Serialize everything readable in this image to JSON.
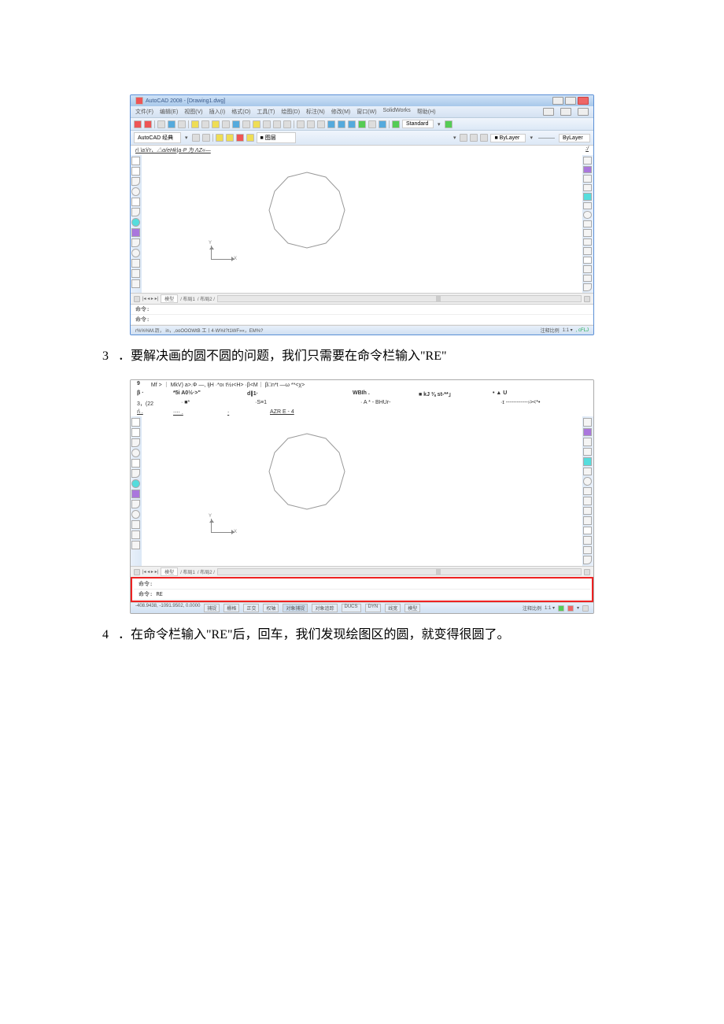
{
  "screenshot1": {
    "window": {
      "title": "AutoCAD 2008 - [Drawing1.dwg]"
    },
    "menubar": [
      "文件(F)",
      "编辑(E)",
      "视图(V)",
      "插入(I)",
      "格式(O)",
      "工具(T)",
      "绘图(D)",
      "标注(N)",
      "修改(M)",
      "窗口(W)",
      "SolidWorks",
      "帮助(H)"
    ],
    "toolbar_right": {
      "style": "Standard",
      "layer": "ByLayer"
    },
    "workspaces": "AutoCAD 经典",
    "crypt_left": "r\\ \\a'ii'r、△α/eHk|a·P 为 ΛZ«—",
    "crypt_right": ":/",
    "tabs": {
      "nav": "|◂ ◂ ▸ ▸|",
      "model": "模型",
      "layout1": "布局1",
      "layout2": "布局2"
    },
    "command": {
      "line1": "命令:",
      "line2": "命令:"
    },
    "status_left": "r%%%M.沥， in，,ooOOOWtB 工丨4·W%I?t1WF»«，EM%?",
    "status_right": {
      "label": "注释比例",
      "scale": "1:1 ▾",
      "extra": ", cFLJ"
    }
  },
  "caption3": {
    "num": "3",
    "text": "．要解决画的圆不圆的问题，我们只需要在命令栏输入\"RE\""
  },
  "screenshot2": {
    "header_rows": {
      "row1": [
        "9",
        "",
        "Mf > ｜ MkV) a>.Φ —, IjH ·*oı t½ı<H> ·β<M｜ β□n*t —ω **<χ>"
      ],
      "row2": [
        "β ·",
        "*5i A0½·>\"",
        "d∥1·",
        "",
        "WBIh .",
        "■ kJ ⅜ st-**」",
        "• ▲ U"
      ],
      "row3": [
        "3，(22",
        "· ■*",
        "·S≡1",
        "",
        "· A * - BHUr-",
        "",
        "·ɪ ------------›><*•"
      ],
      "row4": [
        "ı\\ .",
        "‧‧‧‧ .",
        "‧",
        "AZR E - 4"
      ]
    },
    "tabs": {
      "nav": "|◂ ◂ ▸ ▸|",
      "model": "模型",
      "layout1": "布局1",
      "layout2": "布局2"
    },
    "command": {
      "line1": "命令:",
      "line2": "命令:",
      "value2": "RE"
    },
    "status_left_coords": "-408.9438,  -1091.9502,  0.0000",
    "status_btns": [
      "捕捉",
      "栅格",
      "正交",
      "权轴",
      "对象捕捉",
      "对象追踪",
      "DUCS",
      "DYN",
      "线宽",
      "模型"
    ],
    "status_right": {
      "label": "注释比例",
      "scale": "1:1 ▾"
    }
  },
  "caption4": {
    "num": "4",
    "text": "．在命令栏输入\"RE\"后，回车，我们发现绘图区的圆，就变得很圆了。"
  }
}
